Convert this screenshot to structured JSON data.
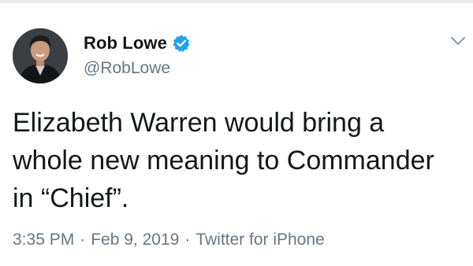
{
  "tweet": {
    "display_name": "Rob Lowe",
    "handle": "@RobLowe",
    "verified": true,
    "text": "Elizabeth Warren would bring a\nwhole new meaning to Commander\nin “Chief”.",
    "time": "3:35 PM",
    "date": "Feb 9, 2019",
    "source": "Twitter for iPhone",
    "separator": "·"
  },
  "colors": {
    "text": "#14171a",
    "secondary": "#657786",
    "verified_blue": "#1da1f2"
  },
  "icons": {
    "verified": "verified-badge-icon",
    "caret": "chevron-down-icon"
  }
}
